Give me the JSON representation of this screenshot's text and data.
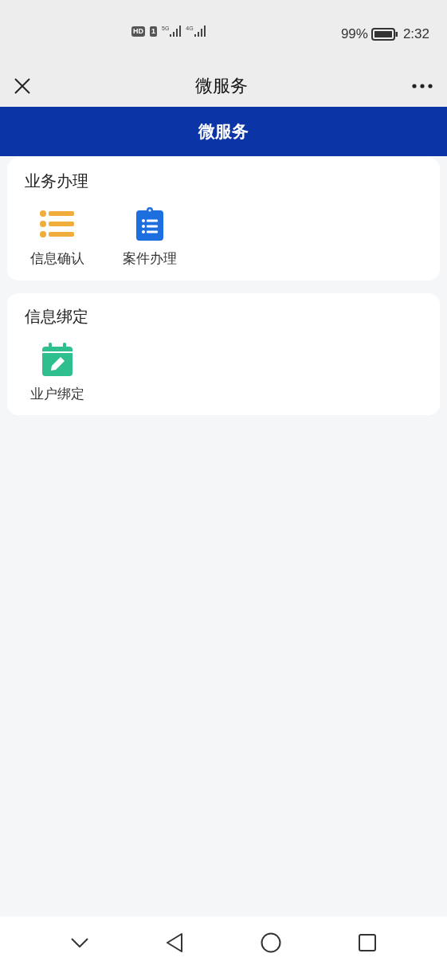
{
  "status_bar": {
    "hd": "HD",
    "sim": "1",
    "networks": [
      "5G",
      "4G"
    ],
    "battery": "99%",
    "time": "2:32"
  },
  "nav_bar": {
    "title": "微服务"
  },
  "banner": {
    "title": "微服务"
  },
  "sections": [
    {
      "title": "业务办理",
      "items": [
        {
          "label": "信息确认",
          "kind": "list"
        },
        {
          "label": "案件办理",
          "kind": "clipboard"
        }
      ]
    },
    {
      "title": "信息绑定",
      "items": [
        {
          "label": "业户绑定",
          "kind": "calendar"
        }
      ]
    }
  ]
}
